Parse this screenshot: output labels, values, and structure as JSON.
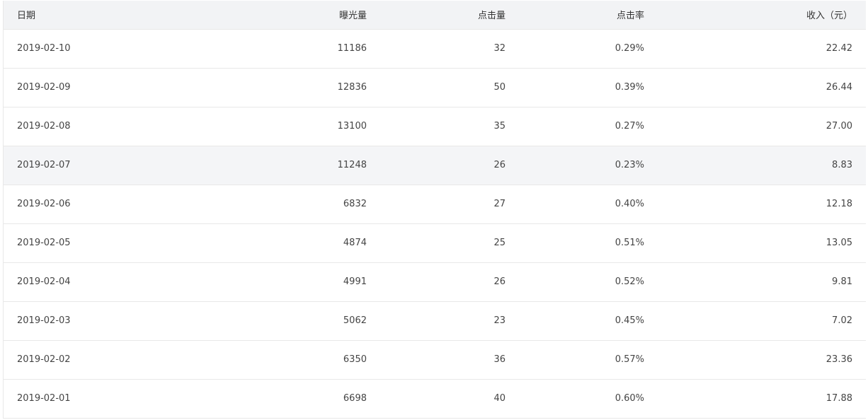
{
  "table": {
    "headers": {
      "date": "日期",
      "impressions": "曝光量",
      "clicks": "点击量",
      "ctr": "点击率",
      "revenue": "收入（元）"
    },
    "rows": [
      {
        "date": "2019-02-10",
        "impressions": "11186",
        "clicks": "32",
        "ctr": "0.29%",
        "revenue": "22.42"
      },
      {
        "date": "2019-02-09",
        "impressions": "12836",
        "clicks": "50",
        "ctr": "0.39%",
        "revenue": "26.44"
      },
      {
        "date": "2019-02-08",
        "impressions": "13100",
        "clicks": "35",
        "ctr": "0.27%",
        "revenue": "27.00"
      },
      {
        "date": "2019-02-07",
        "impressions": "11248",
        "clicks": "26",
        "ctr": "0.23%",
        "revenue": "8.83"
      },
      {
        "date": "2019-02-06",
        "impressions": "6832",
        "clicks": "27",
        "ctr": "0.40%",
        "revenue": "12.18"
      },
      {
        "date": "2019-02-05",
        "impressions": "4874",
        "clicks": "25",
        "ctr": "0.51%",
        "revenue": "13.05"
      },
      {
        "date": "2019-02-04",
        "impressions": "4991",
        "clicks": "26",
        "ctr": "0.52%",
        "revenue": "9.81"
      },
      {
        "date": "2019-02-03",
        "impressions": "5062",
        "clicks": "23",
        "ctr": "0.45%",
        "revenue": "7.02"
      },
      {
        "date": "2019-02-02",
        "impressions": "6350",
        "clicks": "36",
        "ctr": "0.57%",
        "revenue": "23.36"
      },
      {
        "date": "2019-02-01",
        "impressions": "6698",
        "clicks": "40",
        "ctr": "0.60%",
        "revenue": "17.88"
      }
    ]
  },
  "colors": {
    "header_bg": "#f2f3f5",
    "hover_row_bg": "#f4f5f7",
    "border": "#e8e8e8",
    "text": "#333333"
  }
}
